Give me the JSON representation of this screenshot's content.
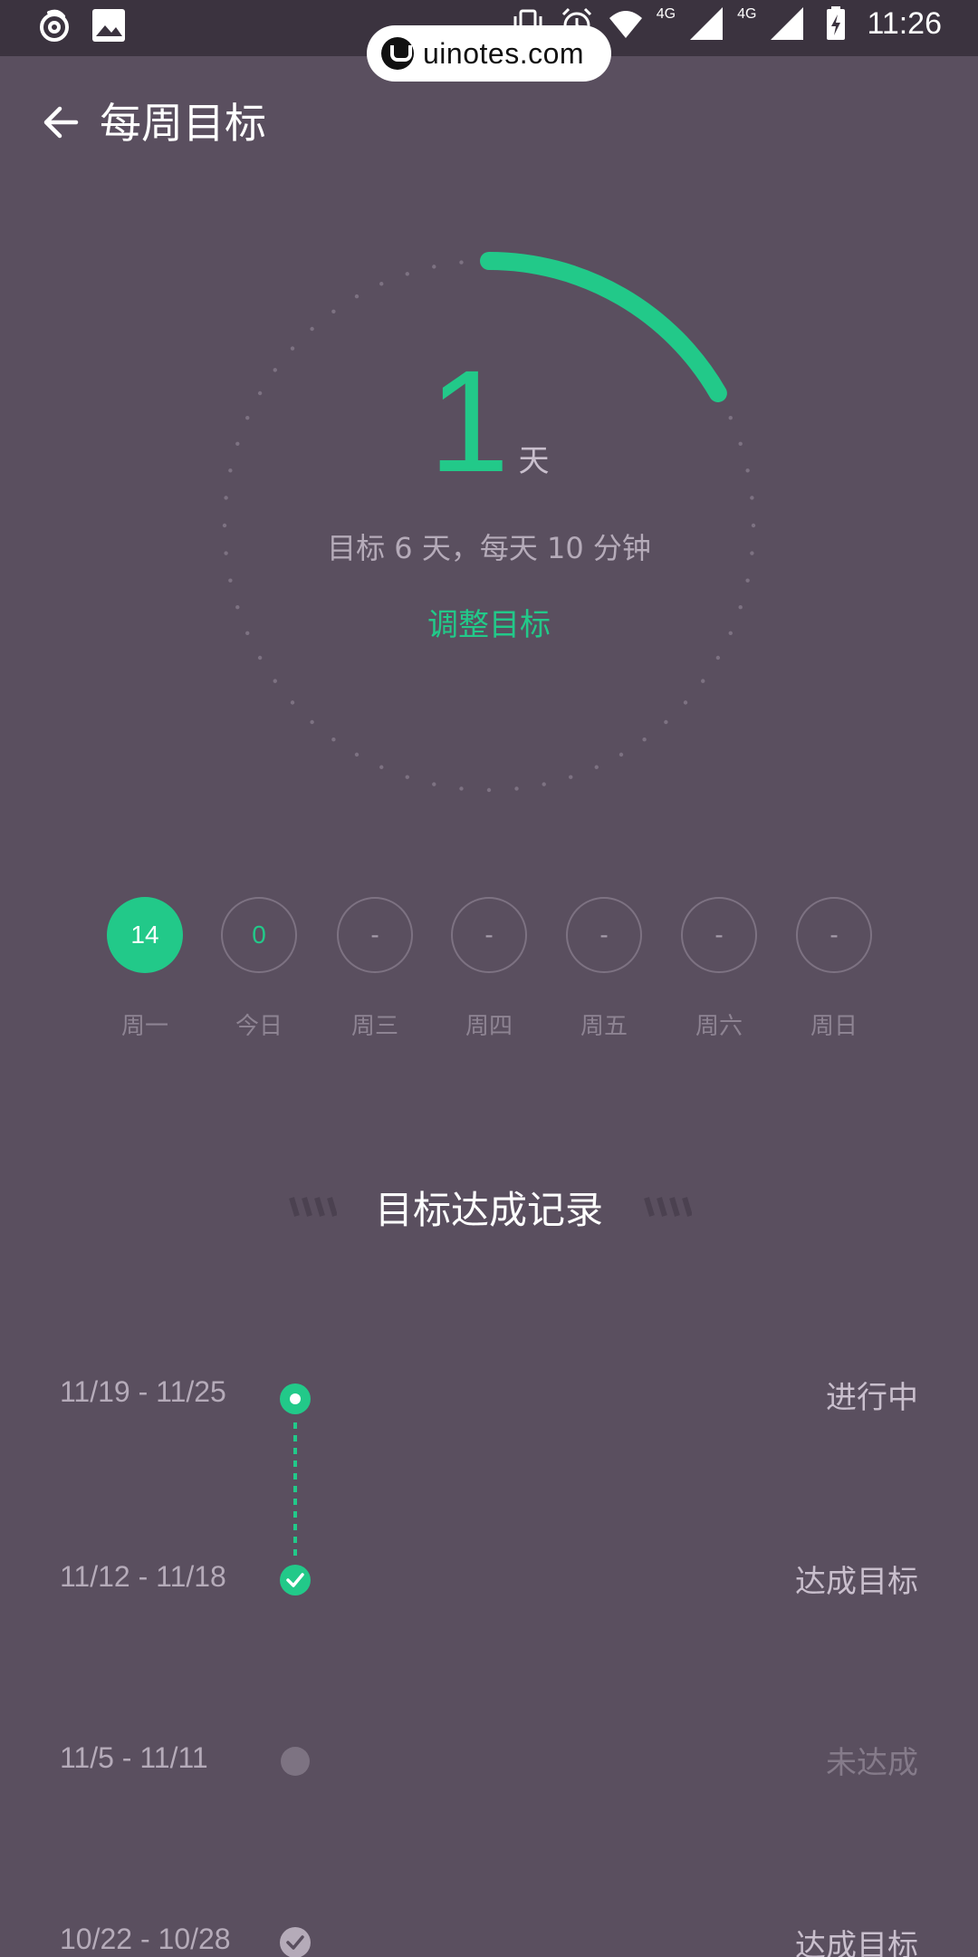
{
  "status_bar": {
    "time": "11:26",
    "network_1": "4G",
    "network_2": "4G",
    "icons": [
      "app-swirl-icon",
      "gallery-icon",
      "vibrate-icon",
      "alarm-icon",
      "wifi-icon",
      "signal-icon",
      "battery-charging-icon"
    ]
  },
  "watermark": {
    "text": "uinotes.com"
  },
  "app_bar": {
    "title": "每周目标",
    "back_icon": "arrow-left-icon"
  },
  "progress": {
    "value": "1",
    "unit": "天",
    "subtitle": "目标 6 天，每天 10 分钟",
    "adjust_label": "调整目标",
    "completed_days": 1,
    "goal_days": 6,
    "accent_color": "#22c989"
  },
  "days": [
    {
      "value": "14",
      "label": "周一",
      "state": "done"
    },
    {
      "value": "0",
      "label": "今日",
      "state": "today"
    },
    {
      "value": "-",
      "label": "周三",
      "state": "future"
    },
    {
      "value": "-",
      "label": "周四",
      "state": "future"
    },
    {
      "value": "-",
      "label": "周五",
      "state": "future"
    },
    {
      "value": "-",
      "label": "周六",
      "state": "future"
    },
    {
      "value": "-",
      "label": "周日",
      "state": "future"
    }
  ],
  "records_section": {
    "title": "目标达成记录",
    "records": [
      {
        "range": "11/19 - 11/25",
        "status": "进行中",
        "state": "in-progress"
      },
      {
        "range": "11/12 - 11/18",
        "status": "达成目标",
        "state": "achieved"
      },
      {
        "range": "11/5 - 11/11",
        "status": "未达成",
        "state": "missed"
      },
      {
        "range": "10/22 - 10/28",
        "status": "达成目标",
        "state": "achieved-past"
      }
    ]
  }
}
